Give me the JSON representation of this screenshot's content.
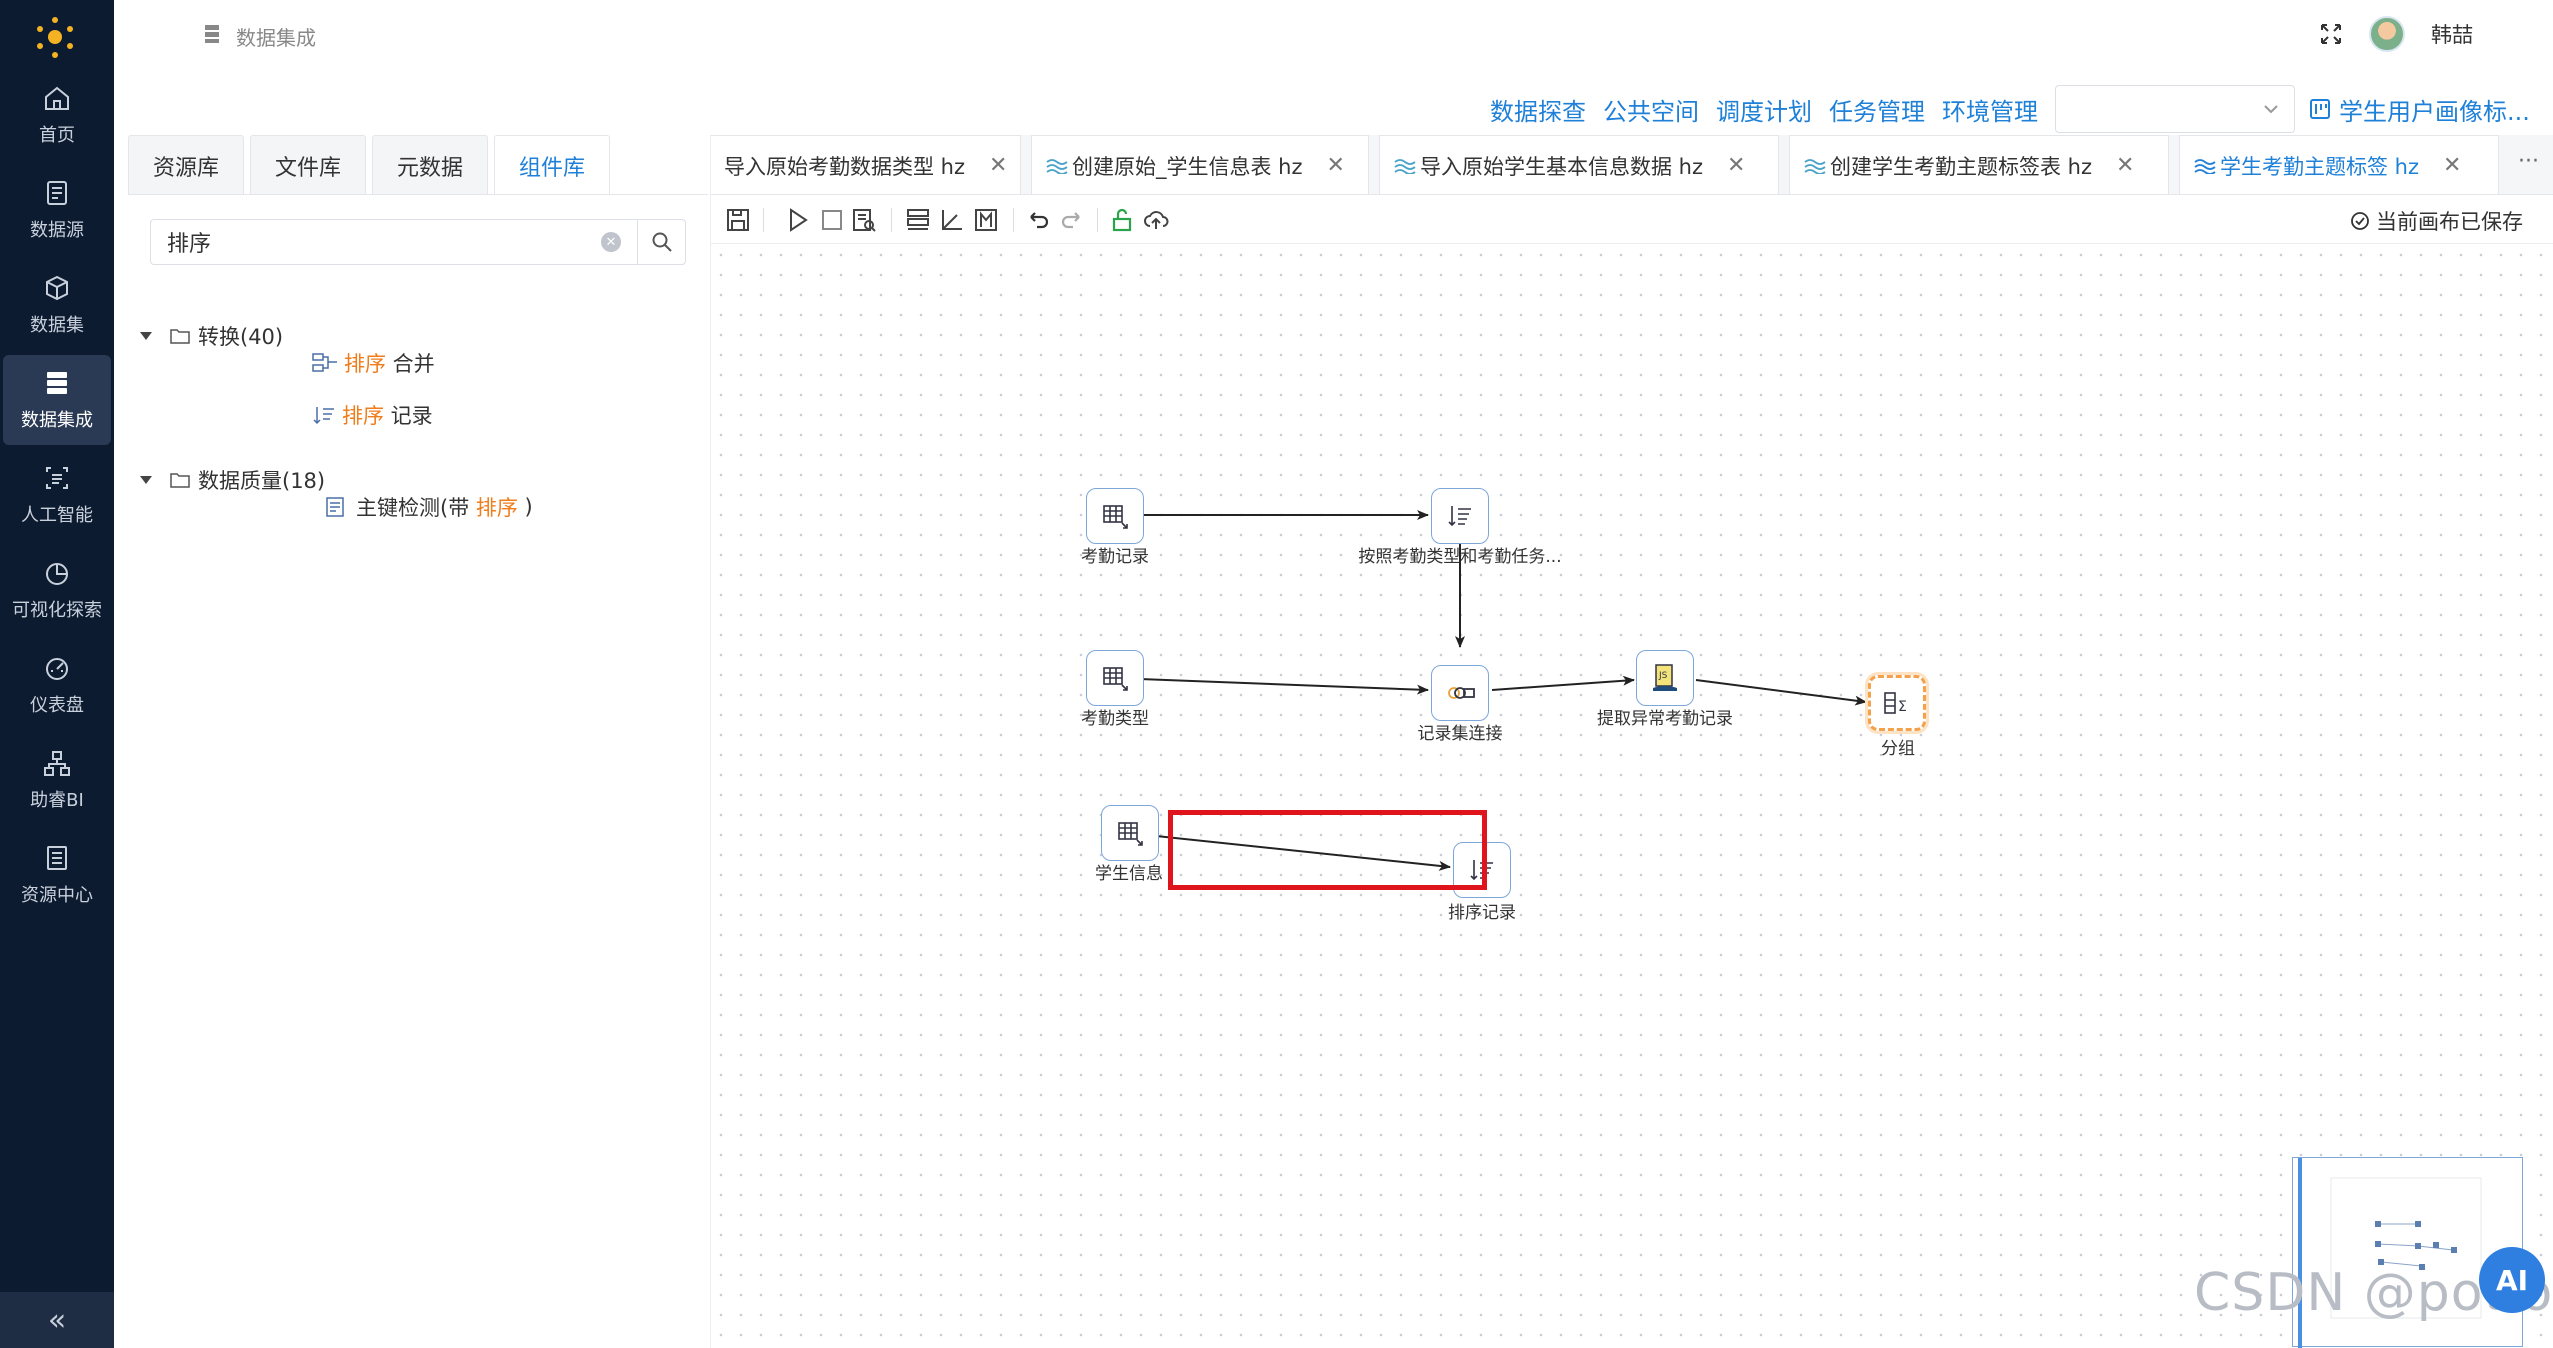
{
  "sidebar": {
    "items": [
      {
        "label": "首页",
        "icon": "home-icon"
      },
      {
        "label": "数据源",
        "icon": "datasource-icon"
      },
      {
        "label": "数据集",
        "icon": "dataset-icon"
      },
      {
        "label": "数据集成",
        "icon": "integration-icon"
      },
      {
        "label": "人工智能",
        "icon": "ai-icon"
      },
      {
        "label": "可视化探索",
        "icon": "pie-chart-icon"
      },
      {
        "label": "仪表盘",
        "icon": "dashboard-icon"
      },
      {
        "label": "助睿BI",
        "icon": "org-chart-icon"
      },
      {
        "label": "资源中心",
        "icon": "resource-icon"
      }
    ],
    "active_index": 3,
    "collapse_glyph": "«"
  },
  "header": {
    "breadcrumb": "数据集成",
    "user_name": "韩喆"
  },
  "top_links": {
    "items": [
      "数据探查",
      "公共空间",
      "调度计划",
      "任务管理",
      "环境管理"
    ],
    "select_value": "",
    "portrait_link": "学生用户画像标..."
  },
  "left_panel": {
    "tabs": [
      "资源库",
      "文件库",
      "元数据",
      "组件库"
    ],
    "active_tab": 3,
    "search": {
      "value": "排序",
      "placeholder": ""
    },
    "tree": {
      "group1": {
        "label": "转换(40)"
      },
      "g1_item1": {
        "highlight": "排序",
        "rest": " 合并"
      },
      "g1_item2": {
        "highlight": "排序",
        "rest": " 记录"
      },
      "group2": {
        "label": "数据质量(18)"
      },
      "g2_item1": {
        "prefix": "主键检测(带 ",
        "highlight": "排序",
        "suffix": " )"
      }
    }
  },
  "doc_tabs": {
    "tabs": [
      {
        "label": "导入原始考勤数据类型 hz"
      },
      {
        "label": "创建原始_学生信息表 hz"
      },
      {
        "label": "导入原始学生基本信息数据 hz"
      },
      {
        "label": "创建学生考勤主题标签表 hz"
      },
      {
        "label": "学生考勤主题标签 hz"
      }
    ],
    "active_index": 4,
    "more": "···"
  },
  "toolbar": {
    "saved_status": "当前画布已保存"
  },
  "canvas": {
    "nodes": {
      "kaoqin_jilu": {
        "label": "考勤记录",
        "icon": "table-input-icon"
      },
      "sort_by_type": {
        "label": "按照考勤类型和考勤任务...",
        "icon": "sort-icon"
      },
      "kaoqin_leixing": {
        "label": "考勤类型",
        "icon": "table-input-icon"
      },
      "record_join": {
        "label": "记录集连接",
        "icon": "join-icon"
      },
      "extract_abnormal": {
        "label": "提取异常考勤记录",
        "icon": "javascript-icon"
      },
      "group": {
        "label": "分组",
        "icon": "group-sum-icon"
      },
      "student_info": {
        "label": "学生信息",
        "icon": "table-input-icon"
      },
      "sort_records": {
        "label": "排序记录",
        "icon": "sort-icon"
      }
    },
    "watermark": "CSDN @potion",
    "ai_button": "AI"
  },
  "colors": {
    "sidebar_bg": "#0d1b30",
    "accent": "#1f80d8",
    "highlight": "#f07d1c",
    "annotation_red": "#e0141c",
    "selected_node": "#f5a04a"
  }
}
